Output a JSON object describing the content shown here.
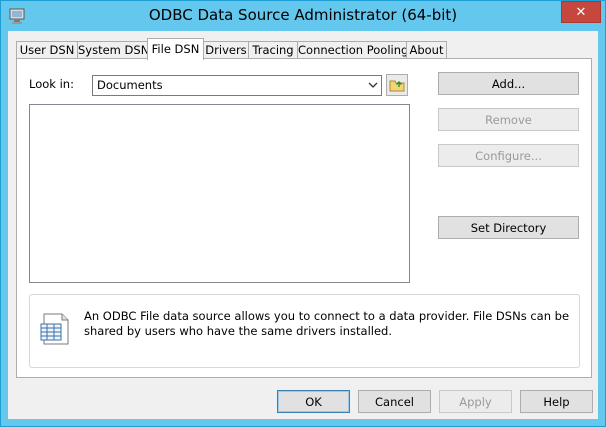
{
  "window": {
    "title": "ODBC Data Source Administrator (64-bit)",
    "close_glyph": "✕"
  },
  "tabs": [
    {
      "label": "User DSN",
      "active": false
    },
    {
      "label": "System DSN",
      "active": false
    },
    {
      "label": "File DSN",
      "active": true
    },
    {
      "label": "Drivers",
      "active": false
    },
    {
      "label": "Tracing",
      "active": false
    },
    {
      "label": "Connection Pooling",
      "active": false
    },
    {
      "label": "About",
      "active": false
    }
  ],
  "file_dsn": {
    "look_in_label": "Look in:",
    "look_in_value": "Documents",
    "buttons": {
      "add": "Add...",
      "remove": "Remove",
      "configure": "Configure...",
      "set_directory": "Set Directory"
    },
    "info_text": "An ODBC File data source allows you to connect to a data provider.  File DSNs can be shared by users who have the same drivers installed."
  },
  "footer": {
    "ok": "OK",
    "cancel": "Cancel",
    "apply": "Apply",
    "help": "Help"
  },
  "colors": {
    "title_bar": "#63c7ee",
    "close_button": "#c7463d",
    "dialog_background": "#f0f0f0"
  }
}
